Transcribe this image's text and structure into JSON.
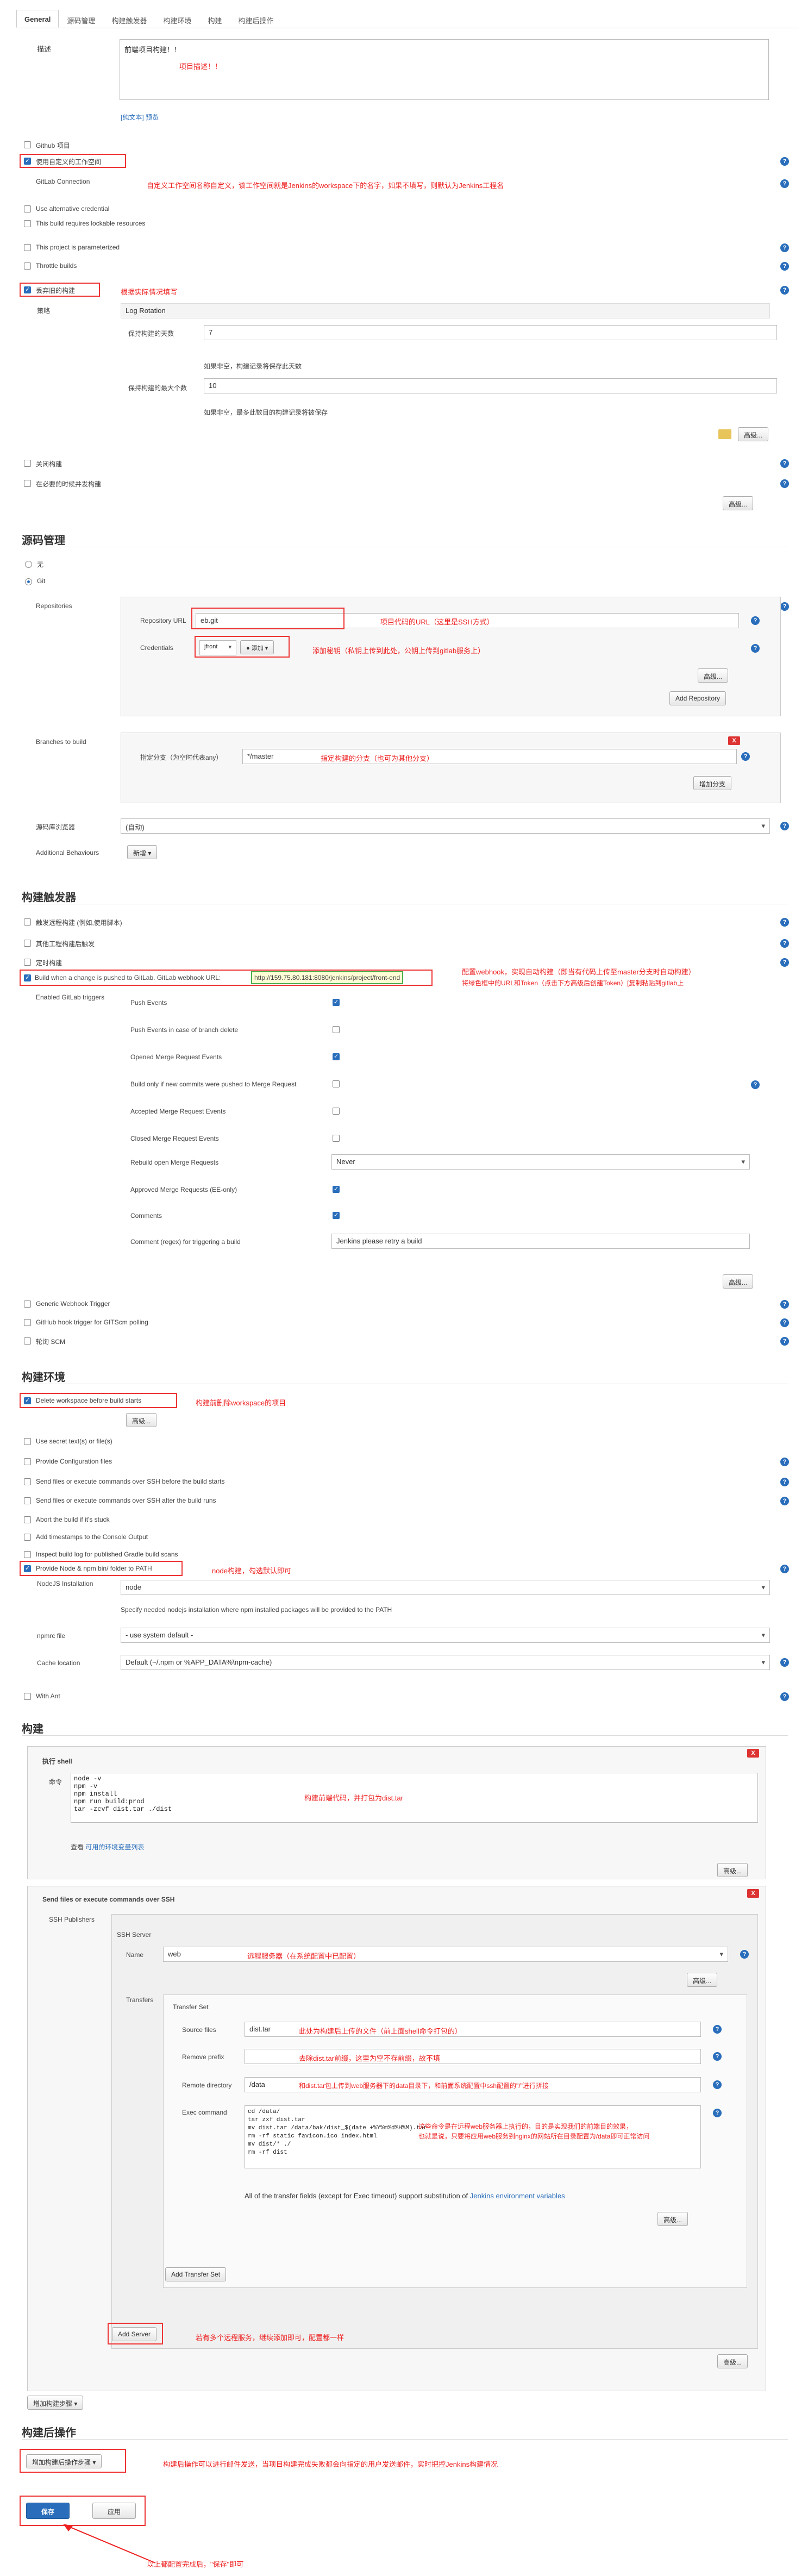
{
  "tabs": [
    "General",
    "源码管理",
    "构建触发器",
    "构建环境",
    "构建",
    "构建后操作"
  ],
  "general": {
    "desc_label": "描述",
    "desc_value": "前端项目构建！！",
    "desc_note": "项目描述！！",
    "desc_footer": "[纯文本] 预览",
    "github_project": "Github 项目",
    "custom_workspace": "使用自定义的工作空间",
    "gitlab_connection": "GitLab Connection",
    "workspace_note": "自定义工作空间名称自定义，该工作空间就是Jenkins的workspace下的名字，如果不填写，则默认为Jenkins工程名",
    "alt_credential": "Use alternative credential",
    "lockable": "This build requires lockable resources",
    "parameterized": "This project is parameterized",
    "throttle": "Throttle builds",
    "discard_old": "丢弃旧的构建",
    "discard_note": "根据实际情况填写",
    "strategy_label": "策略",
    "strategy_value": "Log Rotation",
    "days_label": "保持构建的天数",
    "days_value": "7",
    "days_hint": "如果非空，构建记录将保存此天数",
    "max_label": "保持构建的最大个数",
    "max_value": "10",
    "max_hint": "如果非空，最多此数目的构建记录将被保存",
    "advanced": "高级...",
    "close_build": "关闭构建",
    "concurrent": "在必要的时候并发构建"
  },
  "scm": {
    "title": "源码管理",
    "none": "无",
    "git": "Git",
    "repos_label": "Repositories",
    "url_label": "Repository URL",
    "url_value": "                              eb.git",
    "url_note": "项目代码的URL（这里是SSH方式）",
    "cred_label": "Credentials",
    "cred_value": "jfront",
    "add_btn": "添加",
    "cred_note": "添加秘钥（私钥上传到此处，公钥上传到gitlab服务上）",
    "advanced": "高级...",
    "add_repo": "Add Repository",
    "branches_label": "Branches to build",
    "branch_spec_label": "指定分支（为空时代表any）",
    "branch_value": "*/master",
    "branch_note": "指定构建的分支（也可为其他分支）",
    "add_branch": "增加分支",
    "browser_label": "源码库浏览器",
    "browser_value": "(自动)",
    "behaviours_label": "Additional Behaviours",
    "behaviours_add": "新增"
  },
  "triggers": {
    "title": "构建触发器",
    "remote": "触发远程构建 (例如,使用脚本)",
    "after_other": "其他工程构建后触发",
    "periodic": "定时构建",
    "gitlab_push": "Build when a change is pushed to GitLab. GitLab webhook URL:",
    "webhook_url": "http://159.75.80.181:8080/jenkins/project/front-end",
    "webhook_note1": "配置webhook，实现自动构建（即当有代码上传至master分支时自动构建）",
    "webhook_note2": "将绿色框中的URL和Token（点击下方高级后创建Token）[复制粘贴到gitlab上",
    "enabled_label": "Enabled GitLab triggers",
    "items": [
      {
        "label": "Push Events",
        "checked": true
      },
      {
        "label": "Push Events in case of branch delete",
        "checked": false
      },
      {
        "label": "Opened Merge Request Events",
        "checked": true
      },
      {
        "label": "Build only if new commits were pushed to Merge Request",
        "checked": false
      },
      {
        "label": "Accepted Merge Request Events",
        "checked": false
      },
      {
        "label": "Closed Merge Request Events",
        "checked": false
      }
    ],
    "rebuild_label": "Rebuild open Merge Requests",
    "rebuild_value": "Never",
    "approved": "Approved Merge Requests (EE-only)",
    "comments": "Comments",
    "comment_regex_label": "Comment (regex) for triggering a build",
    "comment_regex_value": "Jenkins please retry a build",
    "advanced": "高级...",
    "generic": "Generic Webhook Trigger",
    "ghprb": "GitHub hook trigger for GITScm polling",
    "poll": "轮询 SCM"
  },
  "env": {
    "title": "构建环境",
    "delete_ws": "Delete workspace before build starts",
    "delete_note": "构建前删除workspace的项目",
    "advanced": "高级...",
    "secret": "Use secret text(s) or file(s)",
    "config_files": "Provide Configuration files",
    "ssh_before": "Send files or execute commands over SSH before the build starts",
    "ssh_after": "Send files or execute commands over SSH after the build runs",
    "abort": "Abort the build if it's stuck",
    "timestamps": "Add timestamps to the Console Output",
    "gradle": "Inspect build log for published Gradle build scans",
    "node": "Provide Node & npm bin/ folder to PATH",
    "node_note": "node构建，勾选默认即可",
    "node_install_label": "NodeJS Installation",
    "node_install_value": "node",
    "node_hint": "Specify needed nodejs installation where npm installed packages will be provided to the PATH",
    "npmrc_label": "npmrc file",
    "npmrc_value": "- use system default -",
    "cache_label": "Cache location",
    "cache_value": "Default (~/.npm or %APP_DATA%\\npm-cache)",
    "ant": "With Ant"
  },
  "build": {
    "title": "构建",
    "shell_title": "执行 shell",
    "cmd_label": "命令",
    "commands": "node -v\nnpm -v\nnpm install\nnpm run build:prod\ntar -zcvf dist.tar ./dist",
    "shell_note": "构建前端代码，并打包为dist.tar",
    "env_link_prefix": "查看",
    "env_link": "可用的环境变量列表",
    "advanced": "高级...",
    "ssh_title": "Send files or execute commands over SSH",
    "publishers_label": "SSH Publishers",
    "server_label": "SSH Server",
    "name_label": "Name",
    "name_value": "web",
    "name_note": "远程服务器（在系统配置中已配置）",
    "transfers_label": "Transfers",
    "transfer_set": "Transfer Set",
    "src_label": "Source files",
    "src_value": "dist.tar",
    "src_note": "此处为构建后上传的文件（前上面shell命令打包的）",
    "remove_label": "Remove prefix",
    "remove_note": "去除dist.tar前缀，这里为空不存前缀，故不填",
    "remote_label": "Remote directory",
    "remote_value": "/data",
    "remote_note": "和dist.tar包上传到web服务器下的data目录下，和前面系统配置中ssh配置的\"/\"进行拼接",
    "exec_label": "Exec command",
    "exec_value": "cd /data/\ntar zxf dist.tar\nmv dist.tar /data/bak/dist_$(date +%Y%m%d%H%M).tar\nrm -rf static favicon.ico index.html\nmv dist/* ./\nrm -rf dist",
    "exec_note1": "这些命令是在远程web服务器上执行的，目的是实现我们的前端目的效果，",
    "exec_note2": "也就是说，只要将应用web服务到nginx的网站所在目录配置为/data即可正常访问",
    "all_fields": "All of the transfer fields (except for Exec timeout) support substitution of",
    "jenkins_env": "Jenkins environment variables",
    "add_transfer": "Add Transfer Set",
    "add_server": "Add Server",
    "server_note": "若有多个远程服务，继续添加即可，配置都一样",
    "add_step": "增加构建步骤"
  },
  "post": {
    "title": "构建后操作",
    "add_btn": "增加构建后操作步骤",
    "note": "构建后操作可以进行邮件发送，当项目构建完成失败都会向指定的用户发送邮件，实时把控Jenkins构建情况"
  },
  "footer": {
    "save": "保存",
    "apply": "应用",
    "note": "以上都配置完成后，\"保存\"即可"
  },
  "colors": {
    "accent": "#2a6ebb",
    "annotation": "#e22222"
  }
}
